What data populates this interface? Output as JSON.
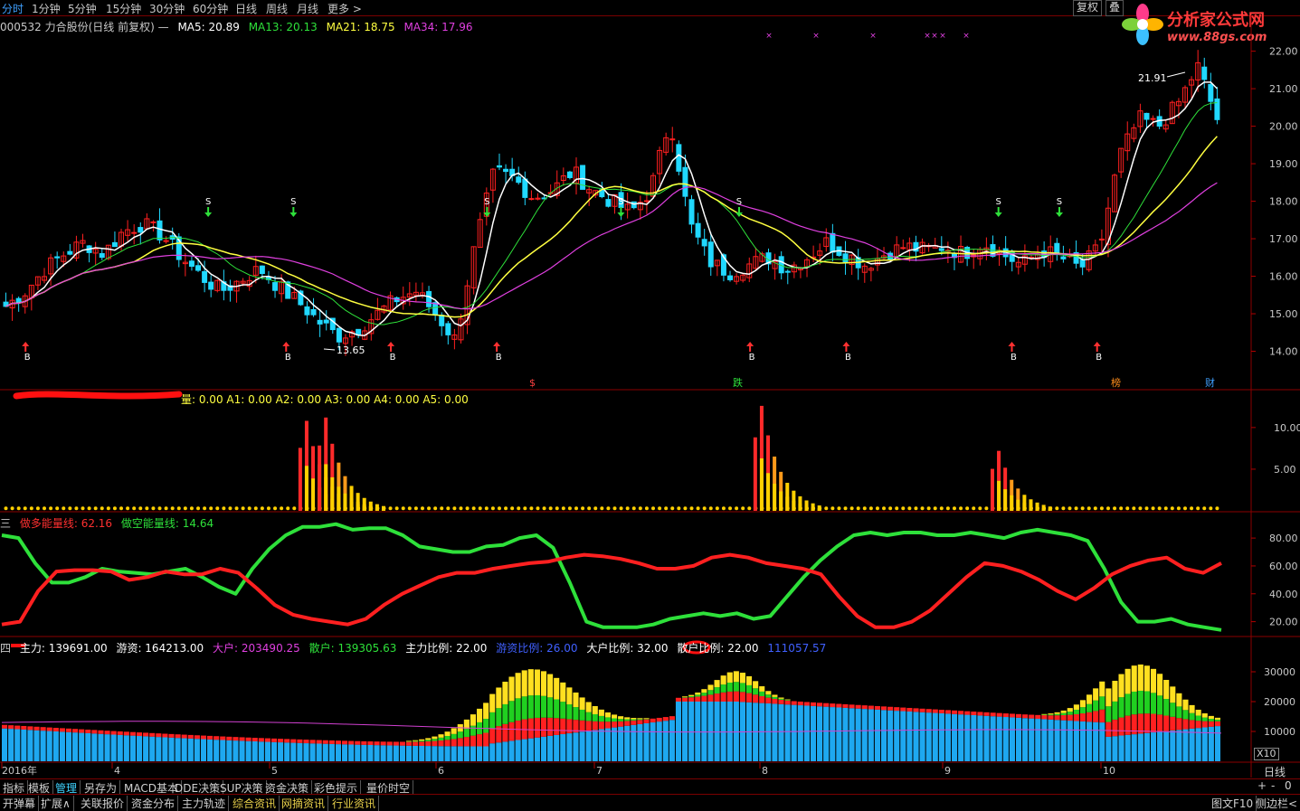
{
  "top_tabs": [
    "分时",
    "1分钟",
    "5分钟",
    "15分钟",
    "30分钟",
    "60分钟",
    "日线",
    "周线",
    "月线",
    "更多 >"
  ],
  "top_right": {
    "restore": "复权",
    "overlay": "叠"
  },
  "logo": {
    "title": "分析家公式网",
    "url": "www.88gs.com"
  },
  "panel1_legend": {
    "name": "000532 力合股份(日线 前复权) —",
    "ma5": "MA5: 20.89",
    "ma13": "MA13: 20.13",
    "ma21": "MA21: 18.75",
    "ma34": "MA34: 17.96"
  },
  "panel2_legend": {
    "values": "量: 0.00   A1: 0.00   A2: 0.00   A3: 0.00   A4: 0.00   A5: 0.00"
  },
  "panel3_legend": {
    "index": "三",
    "bull": "做多能量线: 62.16",
    "bear": "做空能量线: 14.64"
  },
  "panel4_legend": {
    "index": "四",
    "zhuli": "主力: 139691.00",
    "youzi": "游资: 164213.00",
    "dahu": "大户: 203490.25",
    "sanhu": "散户: 139305.63",
    "zhuli_ratio": "主力比例: 22.00",
    "youzi_ratio": "游资比例: 26.00",
    "dahu_ratio": "大户比例: 32.00",
    "sanhu_ratio": "散户比例: 22.00",
    "last": "111057.57"
  },
  "markers": {
    "buy": "B",
    "sell": "S",
    "high_label": "21.91",
    "low_label": "13.65",
    "event_labels": [
      "$",
      "跌",
      "榜",
      "财"
    ]
  },
  "x_axis": {
    "ticks": [
      "2016年",
      "4",
      "5",
      "6",
      "7",
      "8",
      "9",
      "10"
    ],
    "period": "日线",
    "zoom": "X10"
  },
  "bottom_tabs": [
    "指标",
    "模板",
    "管理",
    "另存为",
    "MACD基本",
    "DDE决策",
    "SUP决策",
    "资金决策",
    "彩色提示",
    "量价时空"
  ],
  "bottom_tabs2": [
    "开弹幕",
    "扩展∧",
    "关联报价",
    "资金分布",
    "主力轨迹",
    "综合资讯",
    "网摘资讯",
    "行业资讯"
  ],
  "bottom_right": {
    "zoom_in": "+",
    "zoom_out": "-",
    "pause": "0",
    "ref": "图文F10",
    "side": "侧边栏<"
  },
  "chart_data": [
    {
      "type": "candlestick",
      "ylim": [
        13.0,
        22.4
      ],
      "yticks": [
        14.0,
        15.0,
        16.0,
        17.0,
        18.0,
        19.0,
        20.0,
        21.0,
        22.0
      ],
      "series": [
        {
          "name": "MA5"
        },
        {
          "name": "MA13"
        },
        {
          "name": "MA21"
        },
        {
          "name": "MA34"
        }
      ],
      "key_points": {
        "high": 21.91,
        "low": 13.65,
        "last_close": 20.2
      },
      "path_close": [
        15.2,
        15.6,
        16.2,
        16.6,
        16.9,
        16.6,
        17.2,
        17.4,
        17.1,
        16.5,
        16.0,
        15.6,
        15.9,
        16.2,
        15.7,
        15.3,
        14.8,
        14.4,
        14.6,
        15.0,
        15.4,
        15.6,
        15.0,
        14.3,
        16.8,
        18.8,
        18.6,
        18.1,
        18.3,
        18.8,
        18.3,
        18.0,
        17.7,
        18.3,
        20.2,
        17.4,
        16.4,
        16.1,
        16.3,
        16.5,
        16.2,
        16.5,
        16.9,
        16.6,
        16.3,
        16.6,
        16.8,
        16.7,
        16.8,
        16.6,
        16.9,
        16.6,
        16.3,
        16.7,
        16.5,
        16.2,
        16.8,
        19.2,
        20.2,
        20.0,
        20.6,
        21.6,
        20.2
      ]
    },
    {
      "type": "bar",
      "ylim": [
        0,
        14
      ],
      "yticks": [
        5.0,
        10.0
      ],
      "spikes": [
        {
          "pos": 0.245,
          "peak": 10.8
        },
        {
          "pos": 0.265,
          "peak": 11.2
        },
        {
          "pos": 0.622,
          "peak": 12.6
        },
        {
          "pos": 0.815,
          "peak": 7.2
        }
      ]
    },
    {
      "type": "line",
      "ylim": [
        10,
        95
      ],
      "yticks": [
        20.0,
        40.0,
        60.0,
        80.0
      ],
      "series": [
        {
          "name": "做多能量线",
          "last": 62.16
        },
        {
          "name": "做空能量线",
          "last": 14.64
        }
      ],
      "bull": [
        18,
        20,
        42,
        56,
        57,
        57,
        56,
        50,
        52,
        56,
        54,
        54,
        58,
        55,
        44,
        32,
        25,
        22,
        20,
        18,
        22,
        32,
        40,
        46,
        52,
        55,
        55,
        58,
        60,
        62,
        63,
        66,
        68,
        67,
        65,
        62,
        58,
        58,
        60,
        66,
        68,
        66,
        62,
        60,
        58,
        54,
        38,
        24,
        16,
        16,
        20,
        28,
        40,
        52,
        62,
        60,
        56,
        50,
        42,
        36,
        44,
        54,
        60,
        64,
        66,
        58,
        55,
        62
      ],
      "bear": [
        82,
        80,
        62,
        48,
        48,
        52,
        58,
        56,
        55,
        54,
        56,
        58,
        52,
        45,
        40,
        58,
        72,
        82,
        88,
        88,
        90,
        86,
        87,
        87,
        82,
        74,
        72,
        70,
        70,
        74,
        75,
        80,
        82,
        73,
        48,
        20,
        16,
        16,
        16,
        18,
        22,
        24,
        26,
        24,
        26,
        22,
        24,
        38,
        52,
        64,
        74,
        82,
        84,
        82,
        84,
        84,
        82,
        82,
        84,
        82,
        80,
        84,
        86,
        84,
        82,
        78,
        58,
        34,
        20,
        20,
        22,
        18,
        16,
        14
      ]
    },
    {
      "type": "stacked-bar",
      "ylim": [
        0,
        40000
      ],
      "yticks": [
        10000,
        20000,
        30000
      ],
      "series": [
        {
          "name": "散户"
        },
        {
          "name": "大户"
        },
        {
          "name": "游资"
        },
        {
          "name": "主力"
        }
      ]
    }
  ]
}
